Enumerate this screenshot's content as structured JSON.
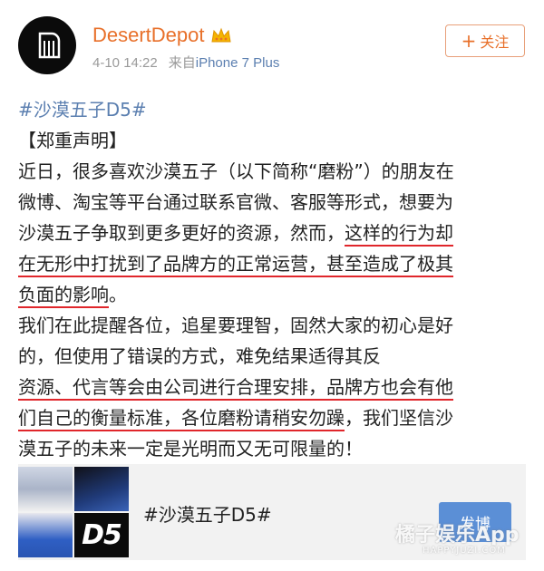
{
  "post": {
    "username": "DesertDepot",
    "time": "4-10 14:22",
    "source_prefix": "来自",
    "device": "iPhone 7 Plus",
    "follow_plus": "+",
    "follow_label": "关注",
    "hashtag": "#沙漠五子D5#",
    "lines": {
      "l1": "【郑重声明】",
      "l2": "近日，很多喜欢沙漠五子（以下简称“磨粉”）的朋友在",
      "l3": "微博、淘宝等平台通过联系官微、客服等形式，想要为",
      "l4a": "沙漠五子争取到更多更好的资源，然而，",
      "l4b": "这样的行为却",
      "l5": "在无形中打扰到了品牌方的正常运营，甚至造成了极其",
      "l6a": "负面的影响",
      "l6b": "。",
      "l7": "我们在此提醒各位，追星要理智，固然大家的初心是好",
      "l8": "的，但使用了错误的方式，难免结果适得其反",
      "l9": "资源、代言等会由公司进行合理安排，品牌方也会有他",
      "l10a": "们自己的衡量标准，各位磨粉请稍安勿躁",
      "l10b": "，我们坚信沙",
      "l11": "漠五子的未来一定是光明而又无可限量的！"
    }
  },
  "card": {
    "title": "#沙漠五子D5#",
    "thumb_text": "D5",
    "button_label": "发博"
  },
  "watermark": {
    "main": "橘子娱乐App",
    "sub": "HAPPYJUZI.COM"
  },
  "colors": {
    "username": "#e8702a",
    "hashtag": "#5b7fb0",
    "underline": "#e0262b",
    "button": "#5b8fd6"
  }
}
